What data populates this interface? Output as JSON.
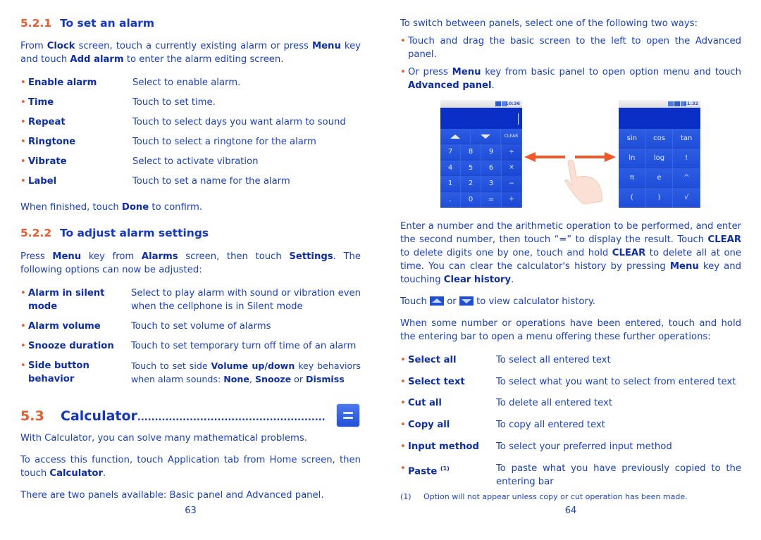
{
  "left_page": {
    "page_number": "63",
    "section_521": {
      "number": "5.2.1",
      "title": "To set an alarm",
      "intro": {
        "t1": "From ",
        "b1": "Clock",
        "t2": " screen, touch a currently existing alarm or press ",
        "b2": "Menu",
        "t3": " key and touch ",
        "b3": "Add alarm",
        "t4": " to enter the alarm editing screen."
      },
      "items": [
        {
          "term": "Enable alarm",
          "desc": "Select to enable alarm."
        },
        {
          "term": "Time",
          "desc": "Touch to set time."
        },
        {
          "term": "Repeat",
          "desc": "Touch to select days you want alarm to sound"
        },
        {
          "term": "Ringtone",
          "desc": "Touch to select a ringtone for the alarm"
        },
        {
          "term": "Vibrate",
          "desc": "Select to activate vibration"
        },
        {
          "term": "Label",
          "desc": "Touch to set a name for the alarm"
        }
      ],
      "outro": {
        "t1": "When finished, touch ",
        "b1": "Done",
        "t2": " to confirm."
      }
    },
    "section_522": {
      "number": "5.2.2",
      "title": "To adjust alarm settings",
      "intro": {
        "t1": "Press ",
        "b1": "Menu",
        "t2": " key from ",
        "b2": "Alarms",
        "t3": " screen, then touch ",
        "b3": "Settings",
        "t4": ". The following options can now be adjusted:"
      },
      "items": [
        {
          "term": "Alarm in silent mode",
          "desc": "Select to play alarm with sound or vibration even when the cellphone is in Silent mode"
        },
        {
          "term": "Alarm volume",
          "desc": "Touch to set volume of alarms"
        },
        {
          "term": "Snooze duration",
          "desc": "Touch to set temporary turn off time of an alarm"
        },
        {
          "term": "Side button behavior",
          "desc_t1": "Touch to set side ",
          "desc_b1": "Volume up/down",
          "desc_t2": " key behaviors when alarm sounds: ",
          "desc_b2": "None",
          "desc_t3": ", ",
          "desc_b3": "Snooze",
          "desc_t4": " or ",
          "desc_b4": "Dismiss"
        }
      ]
    },
    "section_53": {
      "number": "5.3",
      "title": "Calculator",
      "leader": "......................................................",
      "icon": "calculator-equals-icon",
      "p1": "With Calculator, you can solve many mathematical problems.",
      "p2": {
        "t1": "To access this function, touch Application tab from Home screen, then touch ",
        "b1": "Calculator",
        "t2": "."
      },
      "p3": "There are two panels available: Basic panel and Advanced panel."
    }
  },
  "right_page": {
    "page_number": "64",
    "switch_intro": "To switch between panels, select one of the following two ways:",
    "switch_items": [
      {
        "text": "Touch and drag the basic screen to the left to open the Advanced panel."
      },
      {
        "t1": "Or press ",
        "b1": "Menu",
        "t2": " key from basic panel to open option menu and touch ",
        "b2": "Advanced panel",
        "t3": "."
      }
    ],
    "basic_panel": {
      "status_time": "10:36",
      "history_up": "history-up-icon",
      "history_down": "history-down-icon",
      "clear_label": "CLEAR",
      "keys": [
        "7",
        "8",
        "9",
        "÷",
        "4",
        "5",
        "6",
        "×",
        "1",
        "2",
        "3",
        "−",
        ".",
        "0",
        "=",
        "+"
      ]
    },
    "advanced_panel": {
      "status_time": "11:32",
      "keys": [
        "sin",
        "cos",
        "tan",
        "ln",
        "log",
        "!",
        "π",
        "e",
        "^",
        "(",
        ")",
        "√"
      ]
    },
    "gesture_icon": "swipe-hand-icon",
    "para_enter": {
      "t1": "Enter a number and the arithmetic operation to be performed, and enter the second number, then touch “=” to display the result. Touch ",
      "b1": "CLEAR",
      "t2": " to delete digits one by one, touch and hold ",
      "b2": "CLEAR",
      "t3": " to delete all at one time. You can clear the calculator's history by pressing ",
      "b3": "Menu",
      "t4": " key and touching ",
      "b4": "Clear history",
      "t5": "."
    },
    "para_history": {
      "t1": "Touch ",
      "t2": " or ",
      "t3": " to view calculator history."
    },
    "para_hold": "When some number or operations have been entered, touch and hold the entering bar to open a menu offering these further operations:",
    "ops": [
      {
        "term": "Select all",
        "desc": "To select all entered text"
      },
      {
        "term": "Select text",
        "desc": "To select what you want to select from entered text"
      },
      {
        "term": "Cut all",
        "desc": "To delete all entered text"
      },
      {
        "term": "Copy all",
        "desc": "To copy all entered text"
      },
      {
        "term": "Input method",
        "desc": "To select your preferred input method"
      },
      {
        "term": "Paste",
        "sup": "(1)",
        "desc": "To paste what you have previously copied to the entering bar"
      }
    ],
    "footnote": {
      "mark": "(1)",
      "text": "Option will not appear unless copy or cut operation has been made."
    }
  },
  "colors": {
    "text": "#1a3fc9",
    "accent_orange": "#f0582a",
    "calc_blue": "#1746d9"
  }
}
